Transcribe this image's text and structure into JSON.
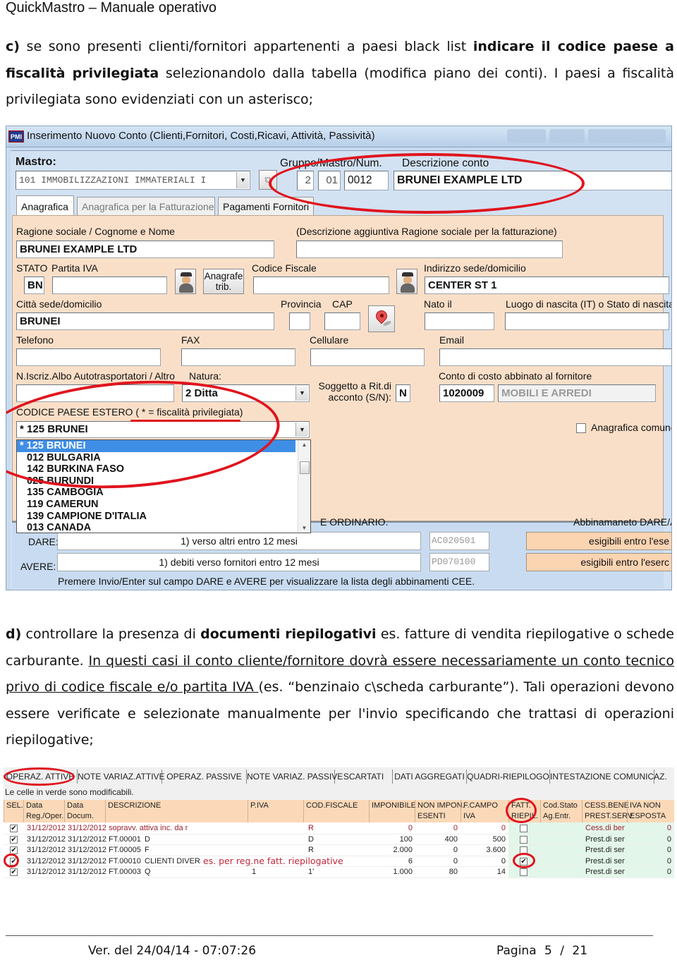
{
  "header": {
    "title": "QuickMastro – Manuale operativo"
  },
  "section_c": {
    "marker": "c)",
    "text_1": " se sono presenti clienti/fornitori appartenenti a paesi black list ",
    "bold_1": "indicare il codice paese a fiscalità privilegiata",
    "text_2": " selezionandolo dalla tabella (modifica piano dei conti). I paesi a fiscalità privilegiata sono evidenziati con un asterisco;"
  },
  "account_window": {
    "logo": "PMI",
    "title": "Inserimento Nuovo Conto (Clienti,Fornitori, Costi,Ricavi, Attività, Passività)",
    "mastro_label": "Mastro:",
    "mastro_value": "101 IMMOBILIZZAZIONI IMMATERIALI I",
    "gruppo_label": "Gruppo/Mastro/Num.",
    "gruppo_value": "2",
    "mastro_num_value": "01",
    "num_value": "0012",
    "descrizione_label": "Descrizione conto",
    "descrizione_value": "BRUNEI EXAMPLE LTD",
    "tabs": [
      {
        "label": "Anagrafica",
        "active": true
      },
      {
        "label": "Anagrafica per la Fatturazione",
        "active": false
      },
      {
        "label": "Pagamenti Fornitori",
        "active": false
      }
    ],
    "fields": {
      "ragione_sociale_label": "Ragione sociale / Cognome e Nome",
      "ragione_sociale_value": "BRUNEI EXAMPLE LTD",
      "descr_aggiuntiva_label": "(Descrizione aggiuntiva  Ragione sociale per la fatturazione)",
      "descr_aggiuntiva_value": "",
      "stato_label": "STATO",
      "stato_value": "BN",
      "partita_iva_label": "Partita IVA",
      "partita_iva_value": "",
      "anagrafe_button": "Anagrafe trib.",
      "codice_fiscale_label": "Codice Fiscale",
      "codice_fiscale_value": "",
      "indirizzo_label": "Indirizzo sede/domicilio",
      "indirizzo_value": "CENTER ST 1",
      "citta_label": "Città sede/domicilio",
      "citta_value": "BRUNEI",
      "provincia_label": "Provincia",
      "provincia_value": "",
      "cap_label": "CAP",
      "cap_value": "",
      "nato_label": "Nato il",
      "nato_value": "",
      "luogo_nascita_label": "Luogo di nascita (IT) o Stato di nascita",
      "luogo_nascita_value": "",
      "telefono_label": "Telefono",
      "telefono_value": "",
      "fax_label": "FAX",
      "fax_value": "",
      "cellulare_label": "Cellulare",
      "cellulare_value": "",
      "email_label": "Email",
      "email_value": "",
      "albo_label": "N.Iscriz.Albo Autotrasportatori / Altro",
      "albo_value": "",
      "natura_label": "Natura:",
      "natura_value": "2 Ditta",
      "ritenuta_label": "Soggetto a Rit.di acconto (S/N):",
      "ritenuta_value": "N",
      "conto_costo_label": "Conto di costo abbinato al fornitore",
      "conto_costo_code": "1020009",
      "conto_costo_desc": "MOBILI E ARREDI",
      "paese_label": "CODICE PAESE ESTERO ( * = fiscalità privilegiata)",
      "paese_value": "* 125 BRUNEI",
      "anagrafica_comune_label": "Anagrafica comune",
      "anagrafica_comune_checked": false
    },
    "country_options": [
      "* 125 BRUNEI",
      "012 BULGARIA",
      "142 BURKINA FASO",
      "025 BURUNDI",
      "135 CAMBOGIA",
      "119 CAMERUN",
      "139 CAMPIONE D'ITALIA",
      "013 CANADA"
    ],
    "country_selected_index": 0,
    "cee": {
      "ordinario_label": "E ORDINARIO.",
      "abbinamento_label": "Abbinamaneto DARE/A",
      "dare_label": "DARE:",
      "dare_value": "1) verso altri entro 12 mesi",
      "dare_code": "AC020501",
      "dare_button": "esigibili entro l'ese",
      "avere_label": "AVERE:",
      "avere_value": "1) debiti verso fornitori entro 12 mesi",
      "avere_code": "PD070100",
      "avere_button": "esigibili entro l'eserc",
      "hint": "Premere Invio/Enter sul campo DARE e AVERE per visualizzare la lista degli abbinamenti CEE."
    }
  },
  "section_d": {
    "marker": "d)",
    "text_1": " controllare la presenza di ",
    "bold_1": "documenti riepilogativi",
    "text_2": " es. fatture di vendita riepilogative o schede carburante. ",
    "underlined": "In questi casi il conto cliente/fornitore dovrà essere necessariamente un conto tecnico privo di codice fiscale e/o partita IVA ",
    "text_3": "(es. “benzinaio c\\scheda carburante”). Tali operazioni devono essere verificate e selezionate manualmente per l'invio specificando che trattasi di operazioni riepilogative;"
  },
  "operations_window": {
    "tabs": [
      "OPERAZ. ATTIVE",
      "NOTE VARIAZ.ATTIVE",
      "OPERAZ. PASSIVE",
      "NOTE VARIAZ. PASSIVE",
      "SCARTATI",
      "DATI AGGREGATI",
      "QUADRI-RIEPILOGO",
      "INTESTAZIONE COMUNICAZ."
    ],
    "active_tab": "OPERAZ. ATTIVE",
    "note": "Le celle in verde sono modificabili.",
    "columns": [
      "SEL.",
      "Data Reg./Oper.",
      "Data Docum.",
      "DESCRIZIONE",
      "P.IVA",
      "COD.FISCALE",
      "IMPONIBILE",
      "NON IMPON. ESENTI",
      "F.CAMPO IVA",
      "FATT. RIEPIL.",
      "Cod.Stato Ag.Entr.",
      "CESS.BENE PREST.SERV.",
      "IVA NON ESPOSTA"
    ],
    "column_lines": [
      [
        "SEL.",
        ""
      ],
      [
        "Data",
        "Reg./Oper."
      ],
      [
        "Data",
        "Docum."
      ],
      [
        "DESCRIZIONE",
        ""
      ],
      [
        "P.IVA",
        ""
      ],
      [
        "COD.FISCALE",
        ""
      ],
      [
        "IMPONIBILE",
        ""
      ],
      [
        "NON IMPON.",
        "ESENTI"
      ],
      [
        "F.CAMPO",
        "IVA"
      ],
      [
        "FATT.",
        "RIEPIL."
      ],
      [
        "Cod.Stato",
        "Ag.Entr."
      ],
      [
        "CESS.BENE",
        "PREST.SERV."
      ],
      [
        "IVA NON",
        "ESPOSTA"
      ]
    ],
    "rows": [
      {
        "sel": true,
        "data_reg": "31/12/2012",
        "data_doc": "31/12/2012",
        "doc": "sopravv. attiva inc. da r:",
        "cliente": "",
        "piva": "",
        "cf": "R",
        "imponibile": "0",
        "non_impon": "0",
        "f_campo": "0",
        "riepil": false,
        "cod_stato": "",
        "cess": "Cess.di beni",
        "iva_non_esp": "0",
        "highlight": true
      },
      {
        "sel": true,
        "data_reg": "31/12/2012",
        "data_doc": "31/12/2012",
        "doc": "FT.00001",
        "cliente": "D",
        "piva": "",
        "cf": "D",
        "imponibile": "100",
        "non_impon": "400",
        "f_campo": "500",
        "riepil": false,
        "cod_stato": "",
        "cess": "Prest.di serviz",
        "iva_non_esp": "0",
        "highlight": false
      },
      {
        "sel": true,
        "data_reg": "31/12/2012",
        "data_doc": "31/12/2012",
        "doc": "FT.00005",
        "cliente": "F",
        "piva": "",
        "cf": "R",
        "imponibile": "2.000",
        "non_impon": "0",
        "f_campo": "3.600",
        "riepil": false,
        "cod_stato": "",
        "cess": "Prest.di serviz",
        "iva_non_esp": "0",
        "highlight": false
      },
      {
        "sel": true,
        "data_reg": "31/12/2012",
        "data_doc": "31/12/2012",
        "doc": "FT.00010",
        "cliente": "CLIENTI DIVERSI",
        "piva": "",
        "cf": "",
        "imponibile": "6",
        "non_impon": "0",
        "f_campo": "0",
        "riepil": true,
        "cod_stato": "",
        "cess": "Prest.di serviz",
        "iva_non_esp": "0",
        "highlight": false
      },
      {
        "sel": true,
        "data_reg": "31/12/2012",
        "data_doc": "31/12/2012",
        "doc": "FT.00003",
        "cliente": "Q",
        "piva": "1",
        "cf": "1'",
        "imponibile": "1.000",
        "non_impon": "80",
        "f_campo": "14",
        "riepil": false,
        "cod_stato": "",
        "cess": "Prest.di serviz",
        "iva_non_esp": "0",
        "highlight": false
      }
    ],
    "annotation": "es. per reg.ne fatt. riepilogative"
  },
  "footer": {
    "version": "Ver. del 24/04/14 - 07:07:26",
    "page_label": "Pagina",
    "page_value": "5 / 21"
  },
  "colors": {
    "annotation_red": "#e0141e",
    "form_peach": "#fadfc8",
    "window_blue": "#c9dbee",
    "header_peach": "#fbd9b8",
    "editable_green": "#e2f6ea",
    "selected_blue": "#3f8ee6"
  }
}
